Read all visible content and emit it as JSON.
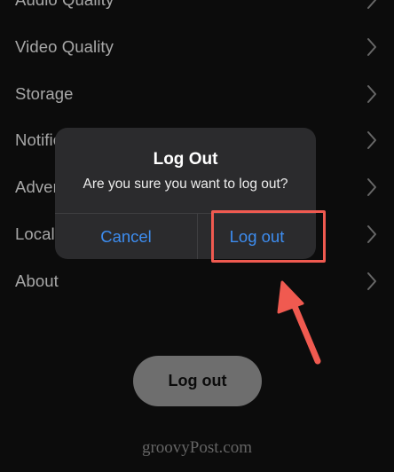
{
  "settings": {
    "items": [
      {
        "label": "Audio Quality"
      },
      {
        "label": "Video Quality"
      },
      {
        "label": "Storage"
      },
      {
        "label": "Notifications"
      },
      {
        "label": "Advertisements"
      },
      {
        "label": "Local Files"
      },
      {
        "label": "About"
      }
    ],
    "logout_button_label": "Log out"
  },
  "dialog": {
    "title": "Log Out",
    "message": "Are you sure you want to log out?",
    "cancel_label": "Cancel",
    "confirm_label": "Log out"
  },
  "watermark": "groovyPost.com",
  "colors": {
    "background": "#131313",
    "dialog": "#2b2b2d",
    "action_blue": "#3d8df0",
    "highlight": "#f05a50",
    "pill": "#a9a9a9"
  }
}
